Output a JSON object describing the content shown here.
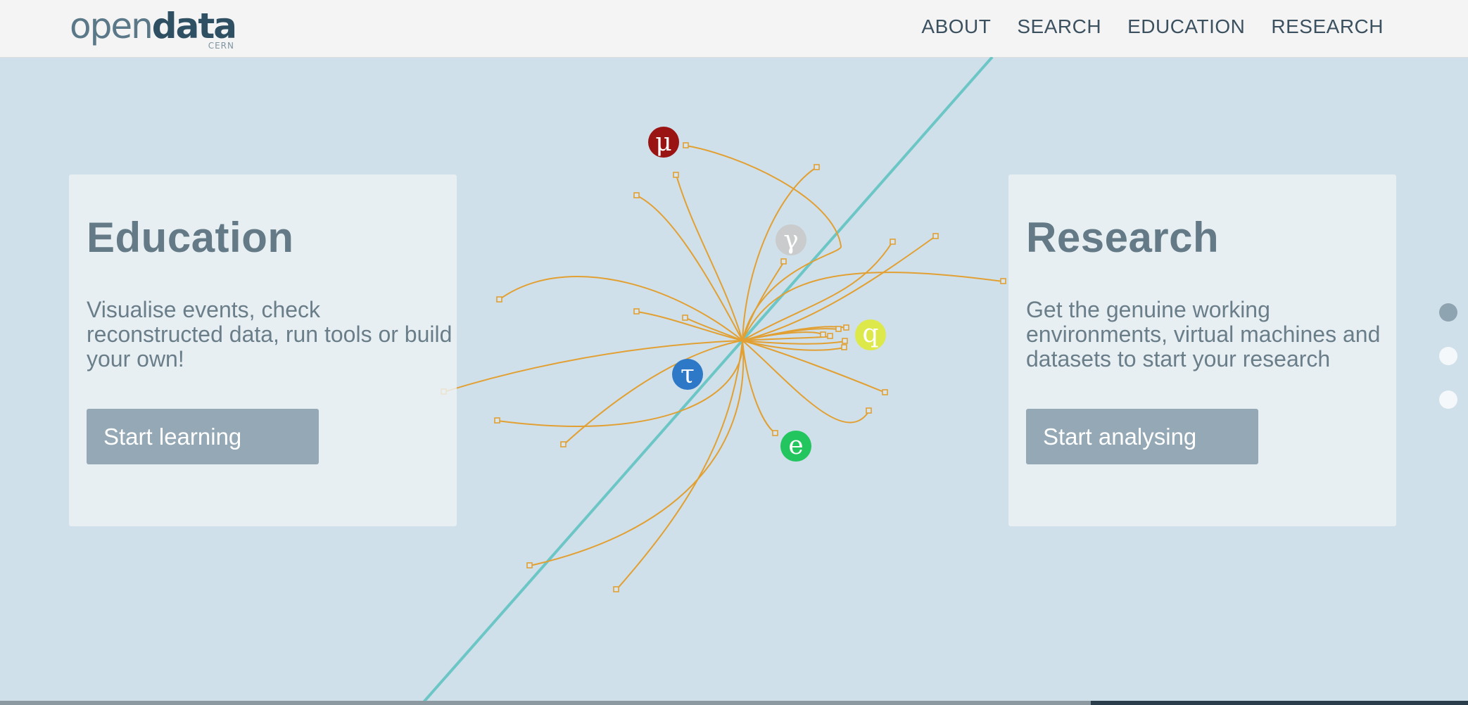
{
  "brand": {
    "logo_thin": "open",
    "logo_bold": "data",
    "logo_sub": "CERN"
  },
  "nav": {
    "items": [
      "ABOUT",
      "SEARCH",
      "EDUCATION",
      "RESEARCH"
    ]
  },
  "education": {
    "title": "Education",
    "text": "Visualise events, check reconstructed data, run tools or build your own!",
    "button": "Start learning"
  },
  "research": {
    "title": "Research",
    "text": "Get the genuine working environments, virtual machines and datasets to start your research",
    "button": "Start analysing"
  },
  "particles": {
    "muon": "μ",
    "photon": "γ",
    "quark": "q",
    "tau": "τ",
    "electron": "e"
  },
  "colors": {
    "background": "#cfe0ea",
    "track": "#e2a033",
    "beam": "#6cc6c6",
    "muon": "#9b1414",
    "photon": "#c9cbcc",
    "quark": "#dde84a",
    "tau": "#2d79c8",
    "electron": "#22c55e"
  },
  "slider": {
    "count": 3,
    "active_index": 0
  }
}
